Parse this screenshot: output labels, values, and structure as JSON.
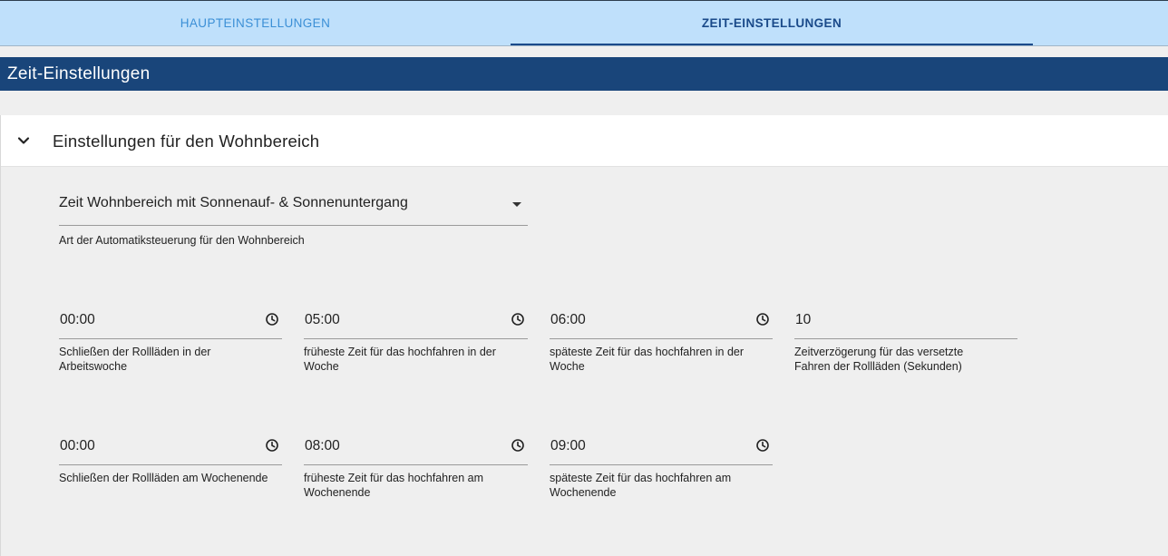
{
  "tabs": [
    {
      "label": "HAUPTEINSTELLUNGEN",
      "active": false
    },
    {
      "label": "ZEIT-EINSTELLUNGEN",
      "active": true
    }
  ],
  "section": {
    "title": "Zeit-Einstellungen"
  },
  "panel": {
    "title": "Einstellungen für den Wohnbereich",
    "expanded": true,
    "icon": "chevron-down-icon",
    "mode": {
      "value": "Zeit Wohnbereich mit Sonnenauf- & Sonnenuntergang",
      "helper": "Art der Automatiksteuerung für den Wohnbereich",
      "icon": "dropdown-arrow-icon"
    },
    "fields": [
      {
        "value": "00:00",
        "label_line1": "Schließen der Rollläden in der",
        "label_line2": "Arbeitswoche",
        "icon": "clock-icon"
      },
      {
        "value": "05:00",
        "label_line1": "früheste Zeit für das hochfahren in der",
        "label_line2": "Woche",
        "icon": "clock-icon"
      },
      {
        "value": "06:00",
        "label_line1": "späteste Zeit für das hochfahren in der",
        "label_line2": "Woche",
        "icon": "clock-icon"
      },
      {
        "value": "10",
        "label_line1": "Zeitverzögerung für das versetzte",
        "label_line2": "Fahren der Rollläden (Sekunden)"
      },
      {
        "value": "00:00",
        "label_line1": "Schließen der Rollläden am Wochenende",
        "label_line2": "",
        "icon": "clock-icon"
      },
      {
        "value": "08:00",
        "label_line1": "früheste Zeit für das hochfahren am",
        "label_line2": "Wochenende",
        "icon": "clock-icon"
      },
      {
        "value": "09:00",
        "label_line1": "späteste Zeit für das hochfahren am",
        "label_line2": "Wochenende",
        "icon": "clock-icon"
      }
    ]
  },
  "colors": {
    "tabbar_bg": "#bfe0fb",
    "tab_active": "#1a4a8a",
    "tab_inactive": "#3b8fd6",
    "section_header_bg": "#19457a",
    "page_bg": "#efefef"
  }
}
